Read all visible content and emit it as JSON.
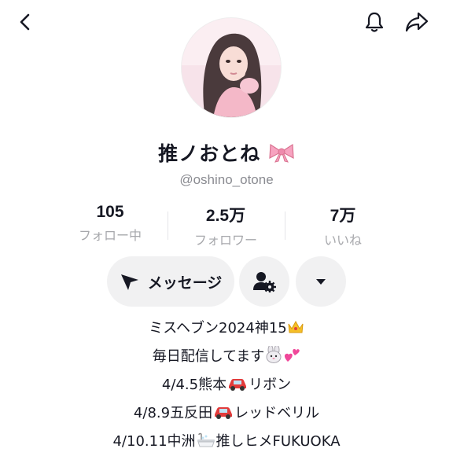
{
  "header": {
    "back_icon": "chevron-left-icon",
    "bell_icon": "bell-icon",
    "share_icon": "share-arrow-icon"
  },
  "profile": {
    "name": "推ノおとね",
    "name_emoji": "ribbon-icon",
    "handle": "@oshino_otone"
  },
  "stats": [
    {
      "value": "105",
      "label": "フォロー中"
    },
    {
      "value": "2.5万",
      "label": "フォロワー"
    },
    {
      "value": "7万",
      "label": "いいね"
    }
  ],
  "actions": {
    "message_label": "メッセージ",
    "message_icon": "send-arrow-icon",
    "user_settings_icon": "user-gear-icon",
    "more_icon": "caret-down-icon"
  },
  "bio": [
    {
      "text": "ミスヘブン2024神15",
      "emoji": "crown-icon"
    },
    {
      "text": "毎日配信してます",
      "emoji": "rabbit-heart-icons"
    },
    {
      "pre": "4/4.5熊本",
      "emoji": "car-icon",
      "post": "リボン"
    },
    {
      "pre": "4/8.9五反田",
      "emoji": "car-icon",
      "post": "レッドベリル"
    },
    {
      "pre": "4/10.11中洲",
      "emoji": "bathtub-icon",
      "post": "推しヒメFUKUOKA"
    }
  ],
  "colors": {
    "text": "#161823",
    "muted": "#a7a8ac",
    "button_bg": "#f1f1f2"
  }
}
